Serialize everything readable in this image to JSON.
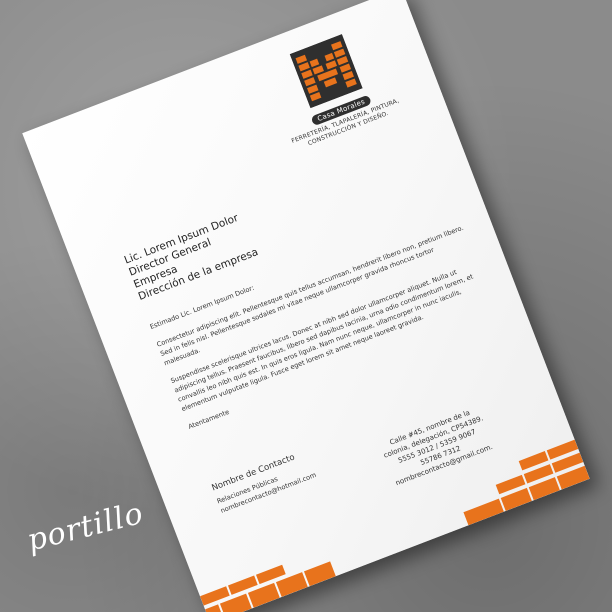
{
  "logo": {
    "letter": "M",
    "name": "Casa Morales",
    "tagline_line1": "FERRETERÍA, TLAPALERÍA, PINTURA,",
    "tagline_line2": "CONSTRUCCIÓN Y DISEÑO."
  },
  "recipient": {
    "line1": "Lic. Lorem Ipsum Dolor",
    "line2": "Director General",
    "line3": "Empresa",
    "line4": "Dirección de la empresa"
  },
  "letter": {
    "greeting": "Estimado Lic. Lorem Ipsum Dolor:",
    "paragraph1": "Consectetur adipiscing elit. Pellentesque quis tellus accumsan, hendrerit libero non, pretium libero. Sed in felis nisl. Pellentesque sodales mi vitae neque ullamcorper gravida rhoncus tortor malesuada.",
    "paragraph2": "Suspendisse scelerisque ultrices lacus. Donec at nibh sed dolor ullamcorper aliquet. Nulla ut adipiscing tellus. Praesent faucibus, libero sed dapibus lacinia, urna odio condimentum lorem, et convallis leo nibh quis est. In quis eros ligula. Nam nunc neque, ullamcorper in nunc iaculis, elementum vulputate ligula. Fusce eget lorem sit amet neque laoreet gravida.",
    "closing": "Atentamente"
  },
  "contact": {
    "name": "Nombre de Contacto",
    "role": "Relaciones Públicas",
    "email": "nombrecontacto@hotmail.com"
  },
  "address": {
    "line1": "Calle #45, nombre de la",
    "line2": "colonia, delegación, CP54389.",
    "line3": "5555 3012 / 5359 9067",
    "line4": "55786 7312",
    "line5": "nombrecontacto@gmail.com."
  },
  "watermark": "portillo",
  "colors": {
    "brand_orange": "#e8731c",
    "brand_dark": "#2f2f2f"
  }
}
